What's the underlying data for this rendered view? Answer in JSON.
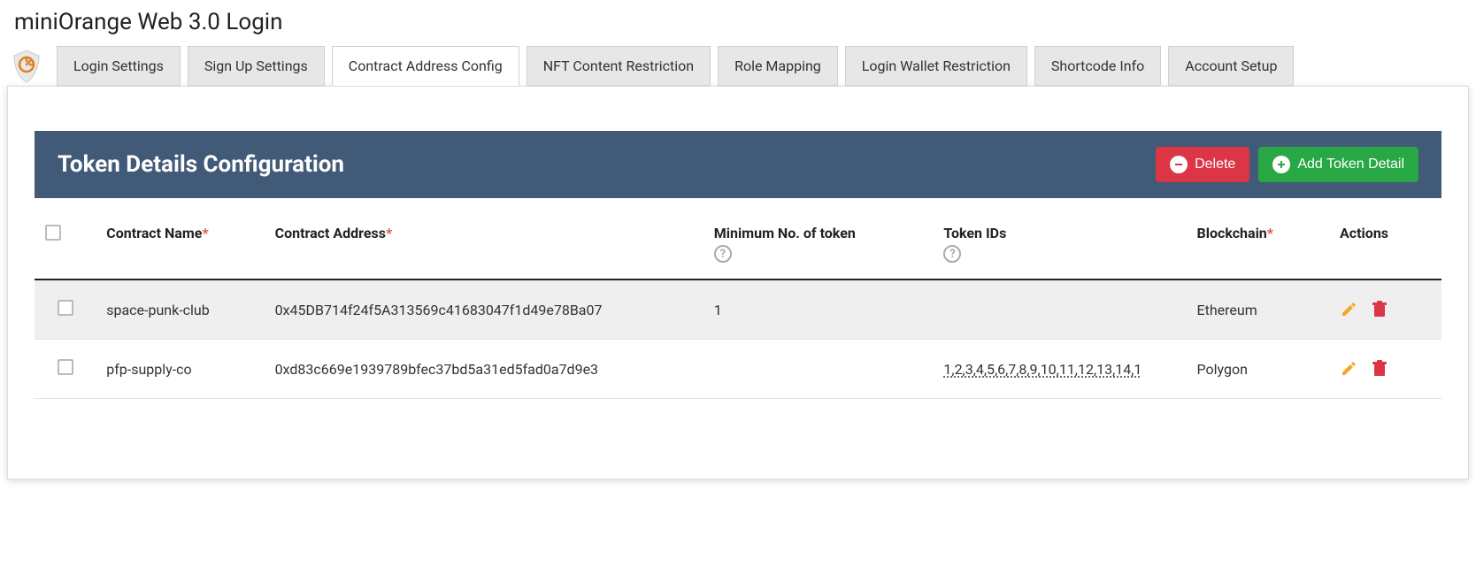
{
  "page_title": "miniOrange Web 3.0 Login",
  "tabs": [
    "Login Settings",
    "Sign Up Settings",
    "Contract Address Config",
    "NFT Content Restriction",
    "Role Mapping",
    "Login Wallet Restriction",
    "Shortcode Info",
    "Account Setup"
  ],
  "active_tab_index": 2,
  "section": {
    "title": "Token Details Configuration",
    "delete_btn": "Delete",
    "add_btn": "Add Token Detail"
  },
  "columns": {
    "contract_name": "Contract Name",
    "contract_address": "Contract Address",
    "min_tokens": "Minimum No. of token",
    "token_ids": "Token IDs",
    "blockchain": "Blockchain",
    "actions": "Actions"
  },
  "rows": [
    {
      "name": "space-punk-club",
      "address": "0x45DB714f24f5A313569c41683047f1d49e78Ba07",
      "min": "1",
      "ids": "",
      "chain": "Ethereum"
    },
    {
      "name": "pfp-supply-co",
      "address": "0xd83c669e1939789bfec37bd5a31ed5fad0a7d9e3",
      "min": "",
      "ids": "1,2,3,4,5,6,7,8,9,10,11,12,13,14,1",
      "chain": "Polygon"
    }
  ]
}
